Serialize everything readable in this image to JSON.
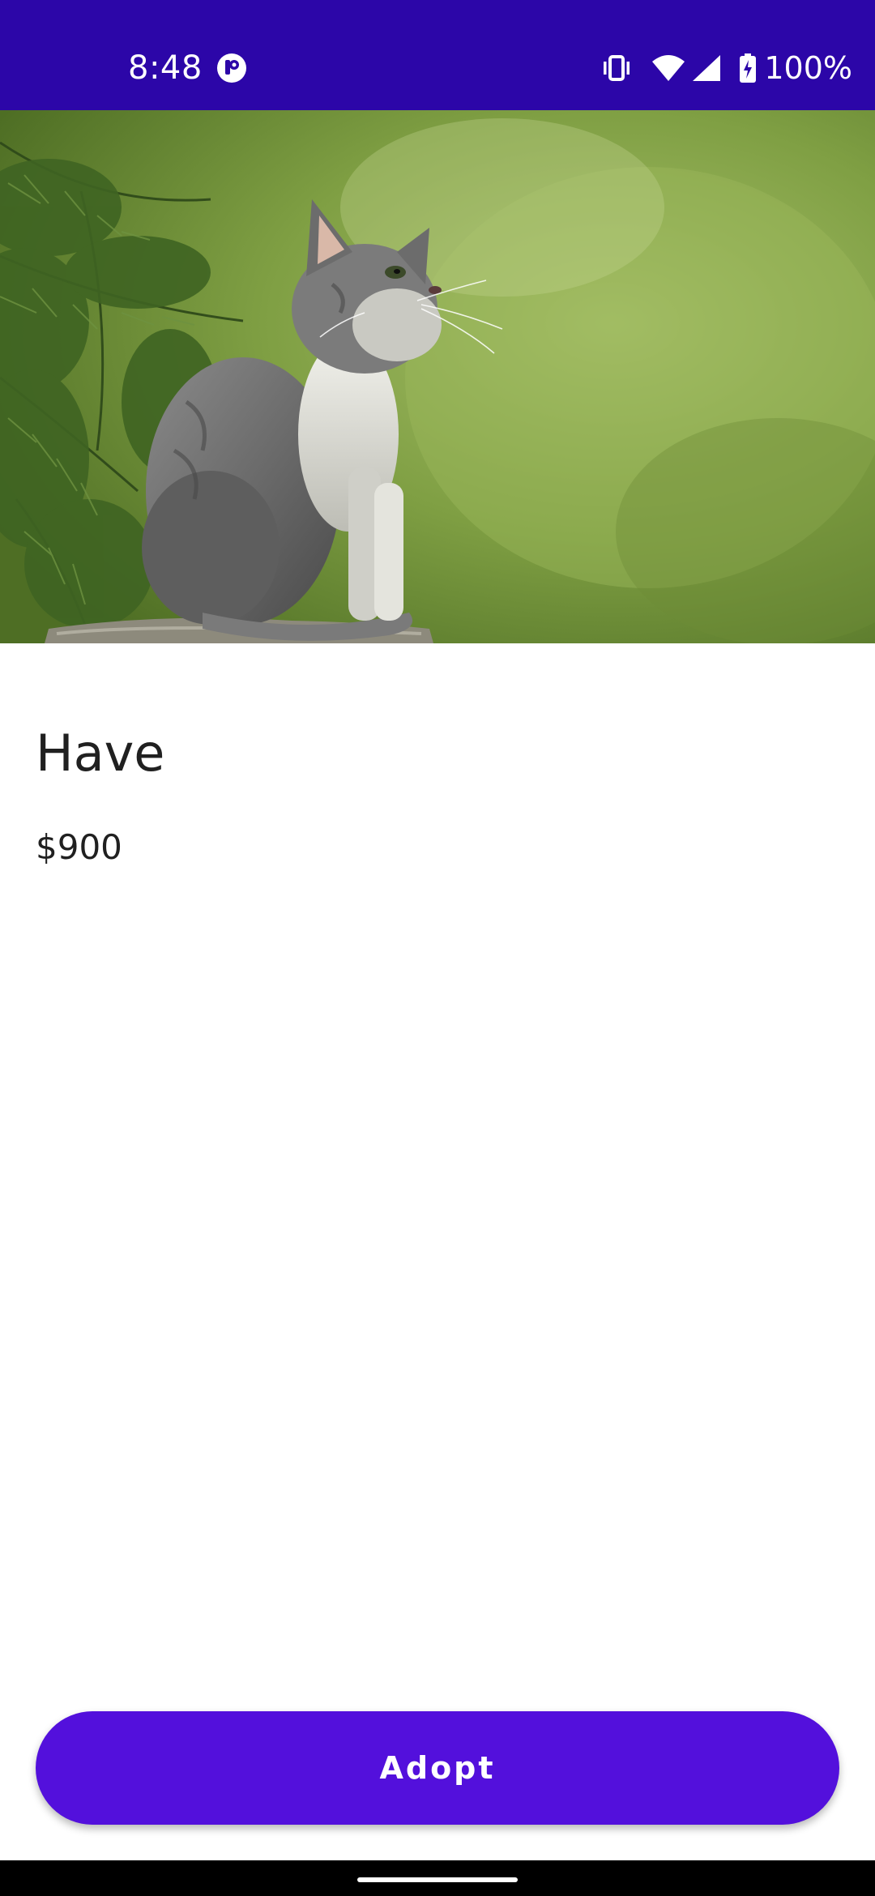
{
  "status_bar": {
    "time": "8:48",
    "battery_text": "100%",
    "background": "#2c06a8",
    "icons": [
      "app-notification-icon",
      "vibrate-icon",
      "wifi-icon",
      "cell-signal-icon",
      "battery-charging-icon"
    ]
  },
  "hero": {
    "image_description_icon": "kitten-photo"
  },
  "pet": {
    "name": "Have",
    "price": "$900"
  },
  "actions": {
    "adopt_label": "Adopt",
    "adopt_color": "#5310dc"
  }
}
